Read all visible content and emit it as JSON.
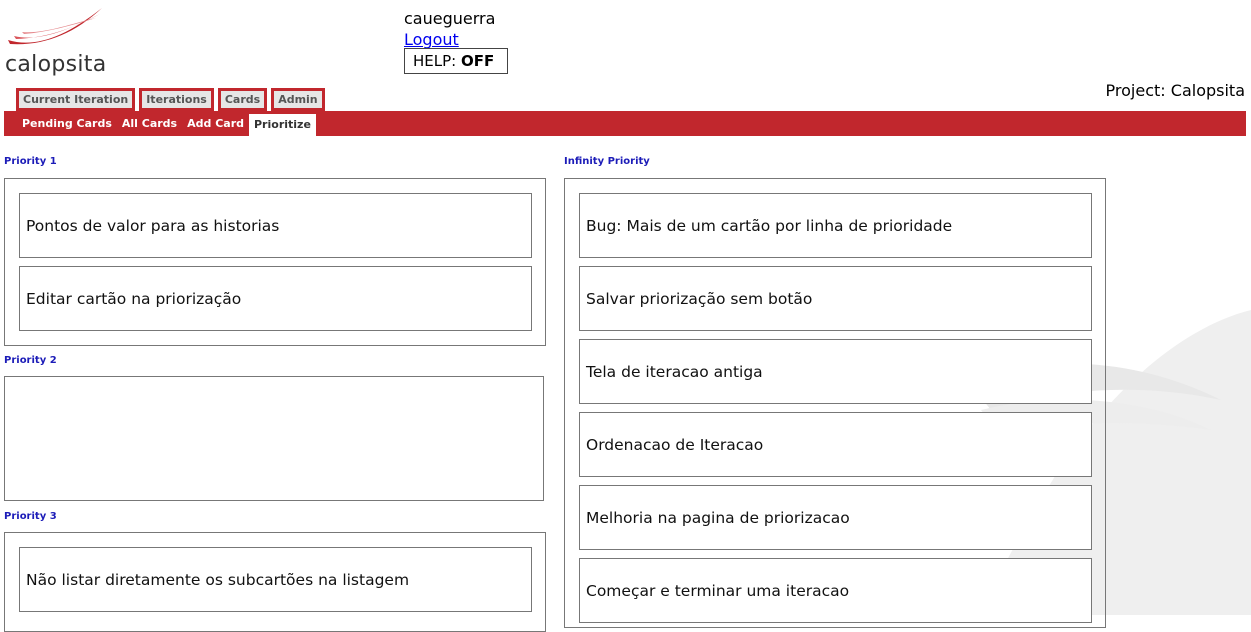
{
  "brand": {
    "name": "calopsita",
    "accent": "#c1272d"
  },
  "user": {
    "username": "caueguerra",
    "logout_label": "Logout"
  },
  "help": {
    "label": "HELP:",
    "state": "OFF"
  },
  "project": {
    "label": "Project: Calopsita"
  },
  "tabs": [
    {
      "label": "Current Iteration"
    },
    {
      "label": "Iterations"
    },
    {
      "label": "Cards"
    },
    {
      "label": "Admin"
    }
  ],
  "subnav": [
    {
      "label": "Pending Cards"
    },
    {
      "label": "All Cards"
    },
    {
      "label": "Add Card"
    },
    {
      "label": "Prioritize",
      "active": true
    }
  ],
  "priorities": [
    {
      "label": "Priority 1",
      "cards": [
        "Pontos de valor para as historias",
        "Editar cartão na priorização"
      ]
    },
    {
      "label": "Priority 2",
      "cards": []
    },
    {
      "label": "Priority 3",
      "cards": [
        "Não listar diretamente os subcartões na listagem"
      ]
    }
  ],
  "infinity": {
    "label": "Infinity Priority",
    "cards": [
      "Bug: Mais de um cartão por linha de prioridade",
      "Salvar priorização sem botão",
      "Tela de iteracao antiga",
      "Ordenacao de Iteracao",
      "Melhoria na pagina de priorizacao",
      "Começar e terminar uma iteracao"
    ]
  }
}
